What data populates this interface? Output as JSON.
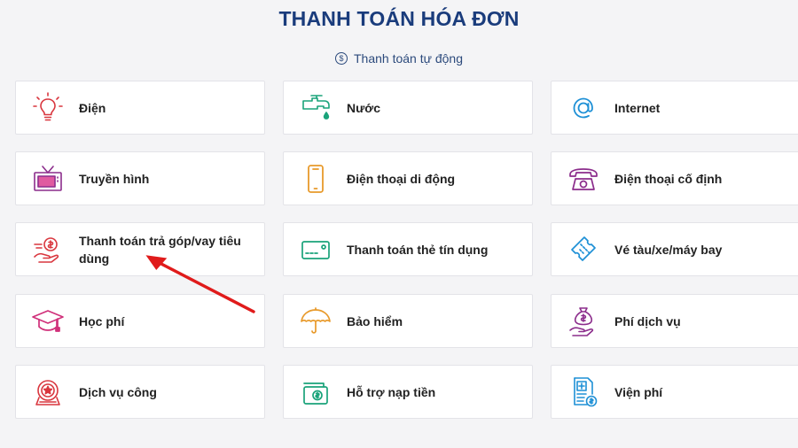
{
  "header": {
    "title": "THANH TOÁN HÓA ĐƠN",
    "auto_link": "Thanh toán tự động",
    "auto_icon": "dollar-coin-icon"
  },
  "colors": {
    "title": "#1a3c7c",
    "red": "#d9363e",
    "green": "#1aa37a",
    "blue": "#1e90d6",
    "purple": "#8c2d8c",
    "orange": "#e89a2b",
    "magenta": "#d0307a",
    "annotation_arrow": "#e01b1b"
  },
  "services": [
    {
      "label": "Điện",
      "icon": "lightbulb-icon"
    },
    {
      "label": "Nước",
      "icon": "water-tap-icon"
    },
    {
      "label": "Internet",
      "icon": "at-sign-icon"
    },
    {
      "label": "Truyền hình",
      "icon": "television-icon"
    },
    {
      "label": "Điện thoại di động",
      "icon": "mobile-phone-icon"
    },
    {
      "label": "Điện thoại cố định",
      "icon": "landline-phone-icon"
    },
    {
      "label": "Thanh toán trả góp/vay tiêu dùng",
      "icon": "loan-hand-money-icon"
    },
    {
      "label": "Thanh toán thẻ tín dụng",
      "icon": "credit-card-icon"
    },
    {
      "label": "Vé tàu/xe/máy bay",
      "icon": "ticket-icon"
    },
    {
      "label": "Học phí",
      "icon": "graduation-cap-icon"
    },
    {
      "label": "Bảo hiểm",
      "icon": "umbrella-icon"
    },
    {
      "label": "Phí dịch vụ",
      "icon": "money-bag-hand-icon"
    },
    {
      "label": "Dịch vụ công",
      "icon": "public-service-emblem-icon"
    },
    {
      "label": "Hỗ trợ nạp tiền",
      "icon": "wallet-topup-icon"
    },
    {
      "label": "Viện phí",
      "icon": "hospital-bill-icon"
    }
  ]
}
